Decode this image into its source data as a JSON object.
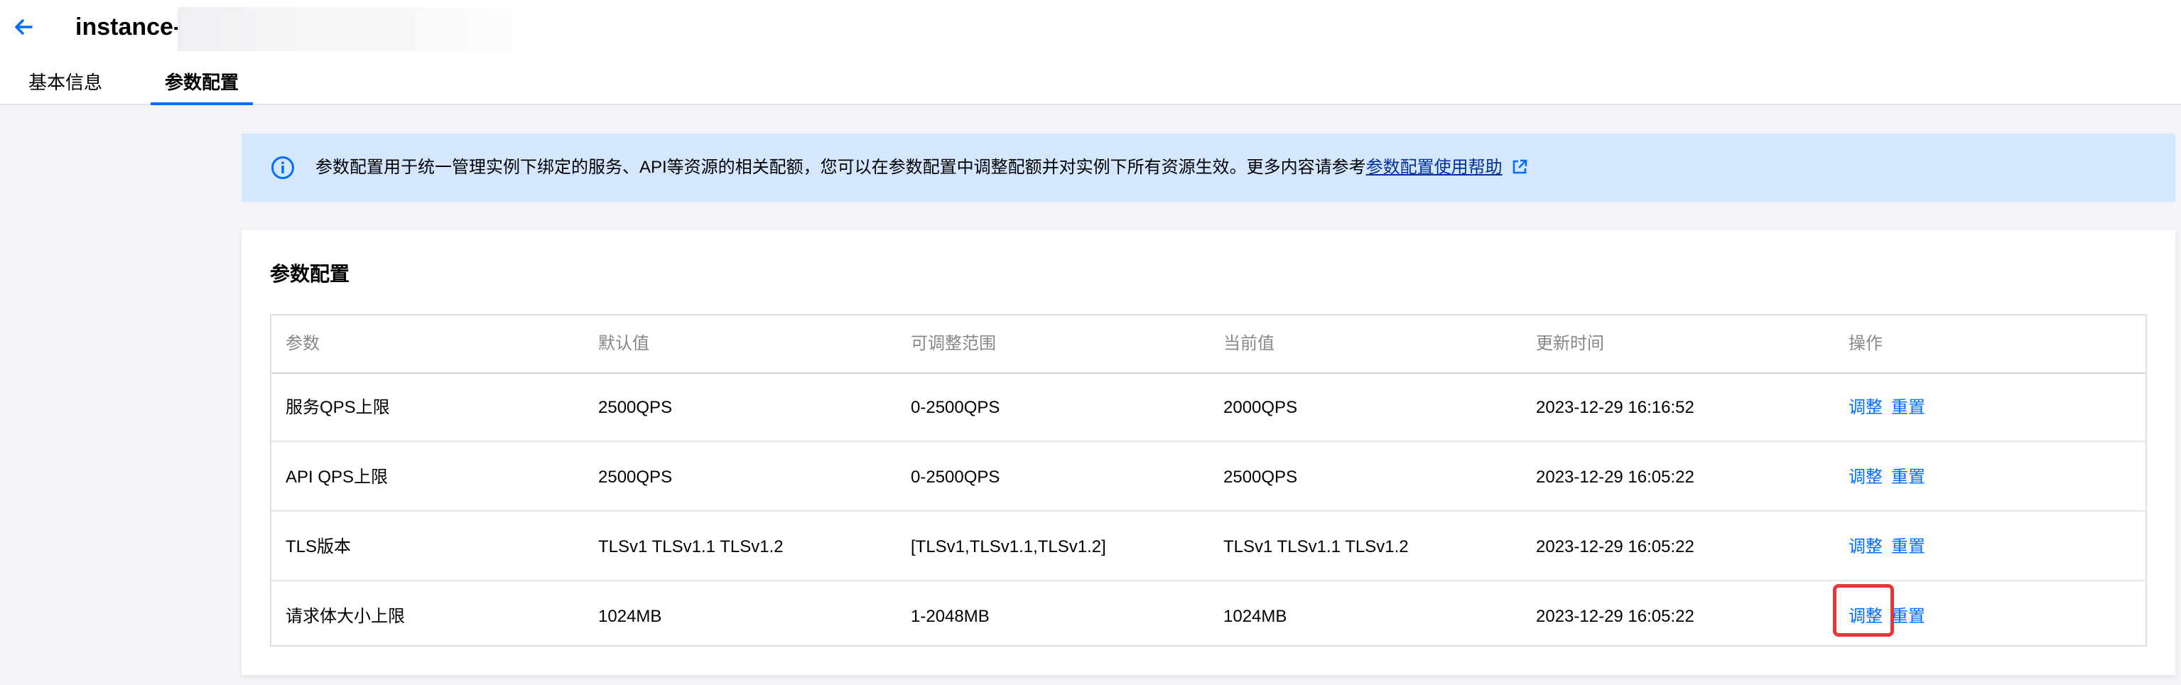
{
  "header": {
    "title": "instance-",
    "back_icon": "arrow-left-icon",
    "accent_color": "#006eff"
  },
  "tabs": [
    {
      "label": "基本信息",
      "active": false
    },
    {
      "label": "参数配置",
      "active": true
    }
  ],
  "notice": {
    "icon": "info-icon",
    "text": "参数配置用于统一管理实例下绑定的服务、API等资源的相关配额，您可以在参数配置中调整配额并对实例下所有资源生效。更多内容请参考",
    "link_text": "参数配置使用帮助",
    "link_icon": "external-link-icon"
  },
  "card": {
    "title": "参数配置",
    "columns": [
      "参数",
      "默认值",
      "可调整范围",
      "当前值",
      "更新时间",
      "操作"
    ],
    "rows": [
      {
        "param": "服务QPS上限",
        "default": "2500QPS",
        "range": "0-2500QPS",
        "current": "2000QPS",
        "updated": "2023-12-29 16:16:52",
        "adjust": "调整",
        "reset": "重置"
      },
      {
        "param": "API QPS上限",
        "default": "2500QPS",
        "range": "0-2500QPS",
        "current": "2500QPS",
        "updated": "2023-12-29 16:05:22",
        "adjust": "调整",
        "reset": "重置"
      },
      {
        "param": "TLS版本",
        "default": "TLSv1 TLSv1.1 TLSv1.2",
        "range": "[TLSv1,TLSv1.1,TLSv1.2]",
        "current": "TLSv1 TLSv1.1 TLSv1.2",
        "updated": "2023-12-29 16:05:22",
        "adjust": "调整",
        "reset": "重置"
      },
      {
        "param": "请求体大小上限",
        "default": "1024MB",
        "range": "1-2048MB",
        "current": "1024MB",
        "updated": "2023-12-29 16:05:22",
        "adjust": "调整",
        "reset": "重置"
      }
    ]
  },
  "colors": {
    "link": "#006eff",
    "notice_bg": "#d5e7ff",
    "page_bg": "#f3f4f7",
    "highlight": "#e8353b"
  }
}
